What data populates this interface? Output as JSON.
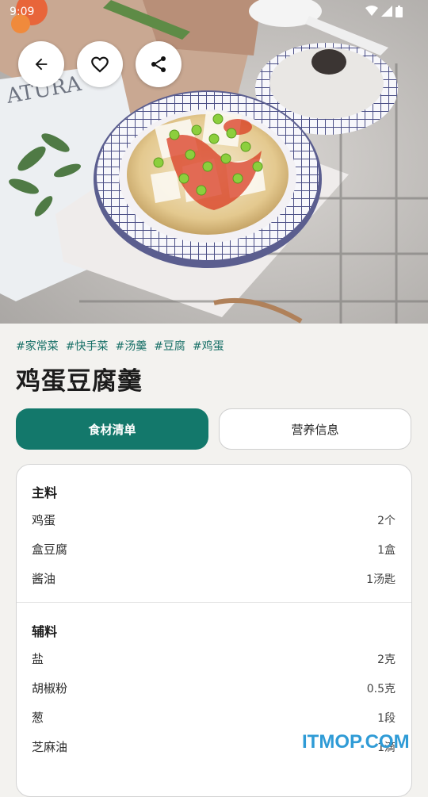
{
  "status_bar": {
    "time": "9:09"
  },
  "hero": {
    "image_alt": "egg tofu soup photo"
  },
  "actions": {
    "back_icon": "arrow-left-icon",
    "favorite_icon": "heart-icon",
    "share_icon": "share-icon"
  },
  "tags": [
    "#家常菜",
    "#快手菜",
    "#汤羹",
    "#豆腐",
    "#鸡蛋"
  ],
  "recipe": {
    "title": "鸡蛋豆腐羹"
  },
  "tabs": {
    "ingredients": "食材清单",
    "nutrition": "营养信息",
    "active": "ingredients"
  },
  "ingredients": {
    "main": {
      "title": "主料",
      "items": [
        {
          "name": "鸡蛋",
          "amount": "2个"
        },
        {
          "name": "盒豆腐",
          "amount": "1盒"
        },
        {
          "name": "酱油",
          "amount": "1汤匙"
        }
      ]
    },
    "secondary": {
      "title": "辅料",
      "items": [
        {
          "name": "盐",
          "amount": "2克"
        },
        {
          "name": "胡椒粉",
          "amount": "0.5克"
        },
        {
          "name": "葱",
          "amount": "1段"
        },
        {
          "name": "芝麻油",
          "amount": "1滴"
        }
      ]
    }
  },
  "watermark": "ITMOP.COM",
  "colors": {
    "accent": "#13786b",
    "tag": "#166f66",
    "watermark": "#2f9bd6"
  }
}
